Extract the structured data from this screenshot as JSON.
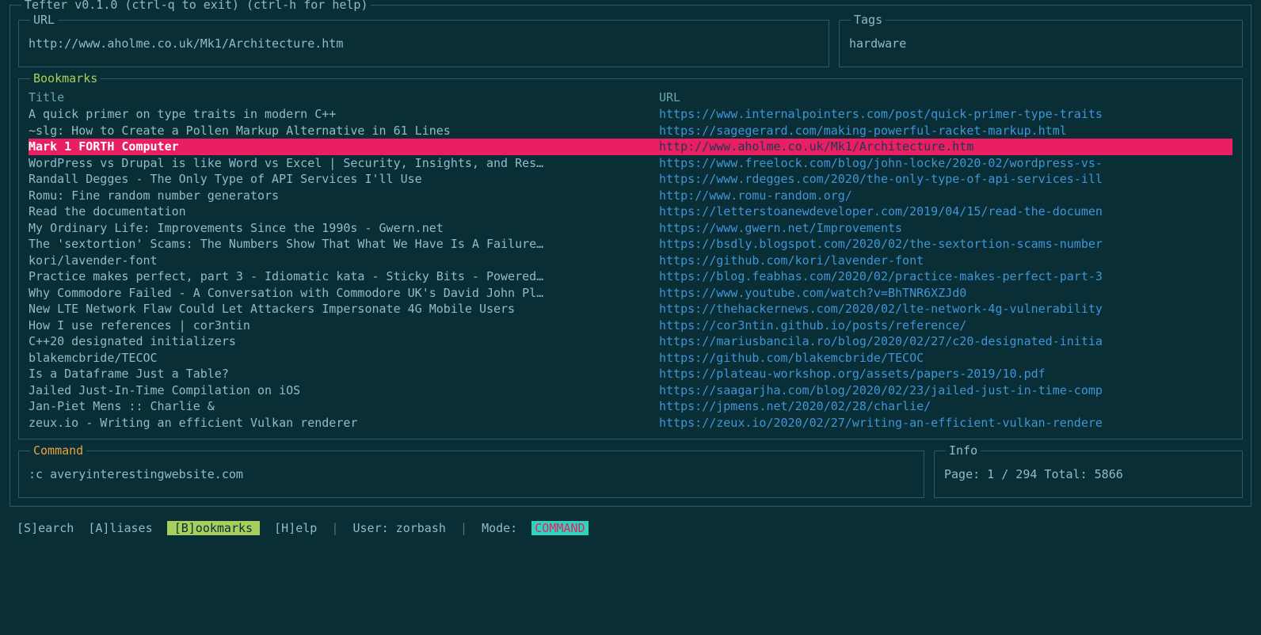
{
  "app_title": "Tefter v0.1.0 (ctrl-q to exit) (ctrl-h for help)",
  "url_section": {
    "label": "URL",
    "value": "http://www.aholme.co.uk/Mk1/Architecture.htm"
  },
  "tags_section": {
    "label": "Tags",
    "value": "hardware"
  },
  "bookmarks_section": {
    "label": "Bookmarks",
    "header_title": "Title",
    "header_url": "URL",
    "selected_index": 2,
    "rows": [
      {
        "title": "A quick primer on type traits in modern C++",
        "url": "https://www.internalpointers.com/post/quick-primer-type-traits"
      },
      {
        "title": "~slg: How to Create a Pollen Markup Alternative in 61 Lines",
        "url": "https://sagegerard.com/making-powerful-racket-markup.html"
      },
      {
        "title": "Mark 1 FORTH Computer",
        "url": "http://www.aholme.co.uk/Mk1/Architecture.htm"
      },
      {
        "title": "WordPress vs Drupal is like Word vs Excel | Security, Insights, and Res…",
        "url": "https://www.freelock.com/blog/john-locke/2020-02/wordpress-vs-"
      },
      {
        "title": "Randall Degges - The Only Type of API Services I'll Use",
        "url": "https://www.rdegges.com/2020/the-only-type-of-api-services-ill"
      },
      {
        "title": "Romu: Fine random number generators",
        "url": "http://www.romu-random.org/"
      },
      {
        "title": "Read the documentation",
        "url": "https://letterstoanewdeveloper.com/2019/04/15/read-the-documen"
      },
      {
        "title": "My Ordinary Life: Improvements Since the 1990s - Gwern.net",
        "url": "https://www.gwern.net/Improvements"
      },
      {
        "title": "The 'sextortion' Scams: The Numbers Show That What We Have Is A Failure…",
        "url": "https://bsdly.blogspot.com/2020/02/the-sextortion-scams-number"
      },
      {
        "title": "kori/lavender-font",
        "url": "https://github.com/kori/lavender-font"
      },
      {
        "title": "Practice makes perfect, part 3 - Idiomatic kata - Sticky Bits - Powered…",
        "url": "https://blog.feabhas.com/2020/02/practice-makes-perfect-part-3"
      },
      {
        "title": "Why Commodore Failed - A Conversation with Commodore UK's David John Pl…",
        "url": "https://www.youtube.com/watch?v=BhTNR6XZJd0"
      },
      {
        "title": "New LTE Network Flaw Could Let Attackers Impersonate 4G Mobile Users",
        "url": "https://thehackernews.com/2020/02/lte-network-4g-vulnerability"
      },
      {
        "title": "How I use references | cor3ntin",
        "url": "https://cor3ntin.github.io/posts/reference/"
      },
      {
        "title": "C++20 designated initializers",
        "url": "https://mariusbancila.ro/blog/2020/02/27/c20-designated-initia"
      },
      {
        "title": "blakemcbride/TECOC",
        "url": "https://github.com/blakemcbride/TECOC"
      },
      {
        "title": "Is a Dataframe Just a Table?",
        "url": "https://plateau-workshop.org/assets/papers-2019/10.pdf"
      },
      {
        "title": "Jailed Just-In-Time Compilation on iOS",
        "url": "https://saagarjha.com/blog/2020/02/23/jailed-just-in-time-comp"
      },
      {
        "title": "Jan-Piet Mens :: Charlie &",
        "url": "https://jpmens.net/2020/02/28/charlie/"
      },
      {
        "title": "zeux.io - Writing an efficient Vulkan renderer",
        "url": "https://zeux.io/2020/02/27/writing-an-efficient-vulkan-rendere"
      }
    ]
  },
  "command_section": {
    "label": "Command",
    "value": ":c averyinterestingwebsite.com"
  },
  "info_section": {
    "label": "Info",
    "value": "Page: 1 / 294 Total: 5866"
  },
  "statusbar": {
    "tabs": [
      {
        "label": "[S]earch",
        "active": false
      },
      {
        "label": "[A]liases",
        "active": false
      },
      {
        "label": "[B]ookmarks",
        "active": true
      },
      {
        "label": "[H]elp",
        "active": false
      }
    ],
    "user_label": "User:",
    "user_value": "zorbash",
    "mode_label": "Mode:",
    "mode_value": "COMMAND"
  }
}
